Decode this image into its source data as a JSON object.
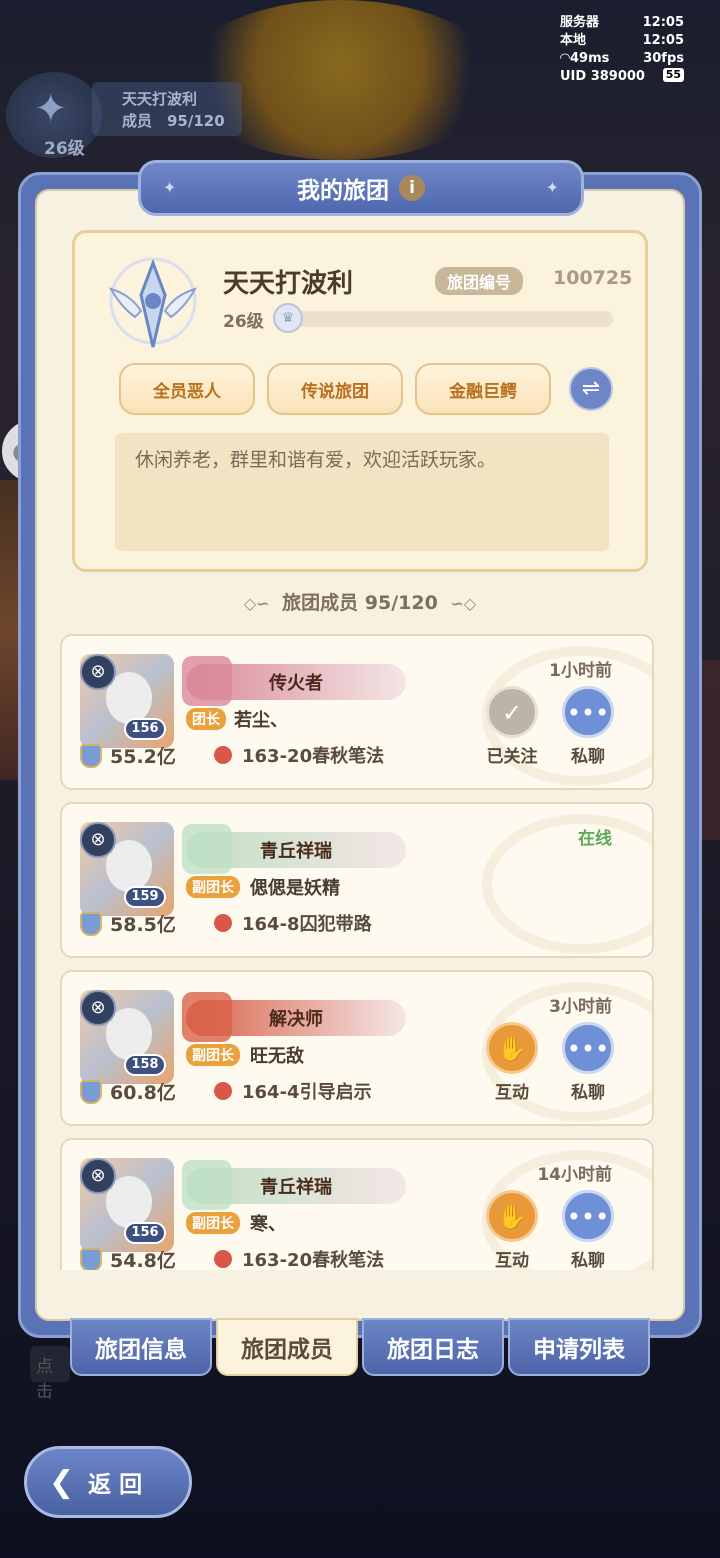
{
  "hud": {
    "server_label": "服务器",
    "server_time": "12:05",
    "local_label": "本地",
    "local_time": "12:05",
    "ping": "49ms",
    "fps": "30fps",
    "uid": "UID 389000",
    "battery": "55"
  },
  "bg_guild_chip": {
    "name": "天天打波利",
    "members": "成员　95/120",
    "level": "26级"
  },
  "panel": {
    "title": "我的旅团",
    "info_icon": "info-icon"
  },
  "guild": {
    "name": "天天打波利",
    "id_label": "旅团编号",
    "id_value": "100725",
    "level": "26级",
    "level_progress": 0.0,
    "tags": [
      "全员恶人",
      "传说旅团",
      "金融巨鳄"
    ],
    "motto": "休闲养老，群里和谐有爱，欢迎活跃玩家。"
  },
  "members_header": "旅团成员 95/120",
  "members": [
    {
      "title": "传火者",
      "role": "团长",
      "name": "若尘、",
      "level": "156",
      "power": "55.2亿",
      "location": "163-20春秋笔法",
      "time": "1小时前",
      "online": false,
      "action1": "已关注",
      "action2": "私聊",
      "title_color": "#d98a9a"
    },
    {
      "title": "青丘祥瑞",
      "role": "副团长",
      "name": "偲偲是妖精",
      "level": "159",
      "power": "58.5亿",
      "location": "164-8囚犯带路",
      "time": "在线",
      "online": true,
      "action1": "",
      "action2": "",
      "title_color": "#bfe0c4"
    },
    {
      "title": "解决师",
      "role": "副团长",
      "name": "旺无敌",
      "level": "158",
      "power": "60.8亿",
      "location": "164-4引导启示",
      "time": "3小时前",
      "online": false,
      "action1": "互动",
      "action2": "私聊",
      "title_color": "#d9634a"
    },
    {
      "title": "青丘祥瑞",
      "role": "副团长",
      "name": "寒、",
      "level": "156",
      "power": "54.8亿",
      "location": "163-20春秋笔法",
      "time": "14小时前",
      "online": false,
      "action1": "互动",
      "action2": "私聊",
      "title_color": "#bfe0c4"
    }
  ],
  "tabs": [
    "旅团信息",
    "旅团成员",
    "旅团日志",
    "申请列表"
  ],
  "active_tab": "旅团成员",
  "hint_text": "点击",
  "back_label": "返 回",
  "colors": {
    "panel_blue": "#5a73b7",
    "cream": "#f7f1e2",
    "accent_orange": "#e8a13b",
    "online_green": "#5da85a"
  }
}
